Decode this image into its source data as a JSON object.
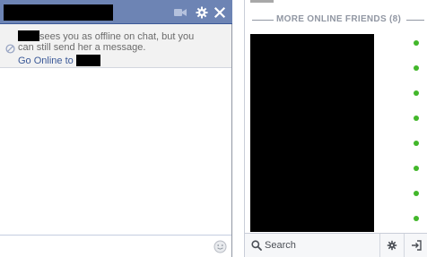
{
  "chat": {
    "header": {
      "name_redacted": true,
      "icons": [
        "video-call-icon",
        "gear-icon",
        "close-icon"
      ]
    },
    "notice": {
      "line1_suffix": "sees you as offline on chat, but you",
      "line2": "can still send her a message.",
      "go_online_label": "Go Online to",
      "icon": "offline-icon"
    },
    "input": {
      "value": "",
      "placeholder": ""
    },
    "emoticon_icon": "emoticon-icon"
  },
  "sidebar": {
    "section_title": "MORE ONLINE FRIENDS (8)",
    "online_count": 8,
    "friends_redacted": true,
    "search_label": "Search",
    "footer_icons": [
      "search-icon",
      "gear-icon",
      "popout-icon"
    ]
  },
  "colors": {
    "header_blue": "#6d84b4",
    "link_blue": "#3b5998",
    "online_green": "#42b72a",
    "muted_text": "#6b6b6b",
    "section_gray": "#9197a3"
  }
}
